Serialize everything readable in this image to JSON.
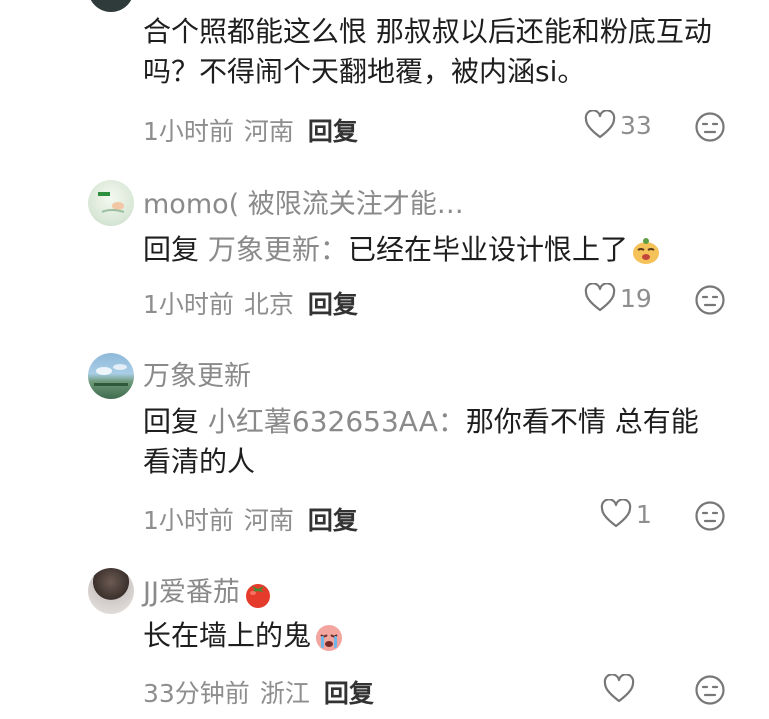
{
  "comments": [
    {
      "name": "",
      "text": "合个照都能这么恨 那叔叔以后还能和粉底互动吗？不得闹个天翻地覆，被内涵si。",
      "time": "1小时前",
      "location": "河南",
      "reply_label": "回复",
      "likes": "33"
    },
    {
      "name": "momo( 被限流关注才能…",
      "reply_prefix": "回复",
      "reply_target": "万象更新：",
      "text": "已经在毕业设计恨上了",
      "emoji": "sly-dog-face-icon",
      "time": "1小时前",
      "location": "北京",
      "reply_label": "回复",
      "likes": "19"
    },
    {
      "name": "万象更新",
      "reply_prefix": "回复",
      "reply_target": "小红薯632653AA：",
      "text": "那你看不情 总有能看清的人",
      "time": "1小时前",
      "location": "河南",
      "reply_label": "回复",
      "likes": "1"
    },
    {
      "name": "JJ爱番茄",
      "name_emoji": "tomato-icon",
      "text": "长在墙上的鬼",
      "emoji": "crying-face-icon",
      "time": "33分钟前",
      "location": "浙江",
      "reply_label": "回复",
      "likes": ""
    }
  ],
  "colors": {
    "muted": "#8a8a8a",
    "text": "#1e1e1e",
    "tomato": "#e53b2c"
  }
}
